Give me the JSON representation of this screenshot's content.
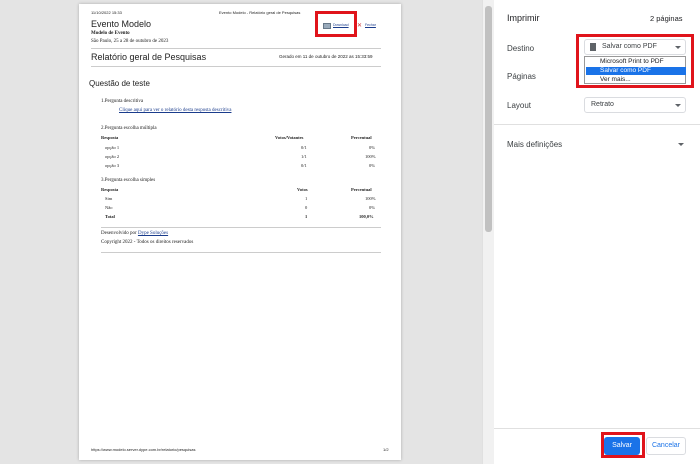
{
  "preview": {
    "header_datetime": "11/10/2022 15:33",
    "header_title": "Evento Modelo - Relatório geral de Pesquisas",
    "event_title": "Evento Modelo",
    "event_subtitle": "Modelo de Evento",
    "event_place_date": "São Paulo, 25 a 28 de outubro de 2023",
    "download_label": "Download",
    "close_label": "Fechar",
    "report_title": "Relatório geral de Pesquisas",
    "generated_at": "Gerado em 11 de outubro de 2022 as 15:33:59",
    "survey_title": "Questão de teste",
    "q1_title": "1.Pergunta descritiva",
    "q1_link": "Clique aqui para ver o relatório desta resposta descritiva",
    "q2_title": "2.Pergunta escolha múltipla",
    "q2_headers": [
      "Resposta",
      "Votos/Votantes",
      "Percentual"
    ],
    "q2_rows": [
      [
        "opção 1",
        "0/1",
        "0%"
      ],
      [
        "opção 2",
        "1/1",
        "100%"
      ],
      [
        "opção 3",
        "0/1",
        "0%"
      ]
    ],
    "q3_title": "3.Pergunta escolha simples",
    "q3_headers": [
      "Resposta",
      "Votos",
      "Percentual"
    ],
    "q3_rows": [
      [
        "Sim",
        "1",
        "100%"
      ],
      [
        "Não",
        "0",
        "0%"
      ],
      [
        "Total",
        "1",
        "100,0%"
      ]
    ],
    "dev_prefix": "Desenvolvido por ",
    "dev_link": "Dype Soluções",
    "copyright": "Copyright 2022 - Todos os direitos reservados",
    "footer_url": "https://www.modelo.server.dype.com.br/relatorio/pesquisas",
    "footer_page": "1/2"
  },
  "panel": {
    "title": "Imprimir",
    "page_count": "2 páginas",
    "destination_label": "Destino",
    "destination_value": "Salvar como PDF",
    "destination_options": [
      "Microsoft Print to PDF",
      "Salvar como PDF",
      "Ver mais..."
    ],
    "pages_label": "Páginas",
    "layout_label": "Layout",
    "layout_value": "Retrato",
    "more_settings_label": "Mais definições",
    "save_label": "Salvar",
    "cancel_label": "Cancelar"
  },
  "colors": {
    "accent": "#1a73e8",
    "highlight": "#e0141b",
    "selected_option": "#1a73e8"
  }
}
